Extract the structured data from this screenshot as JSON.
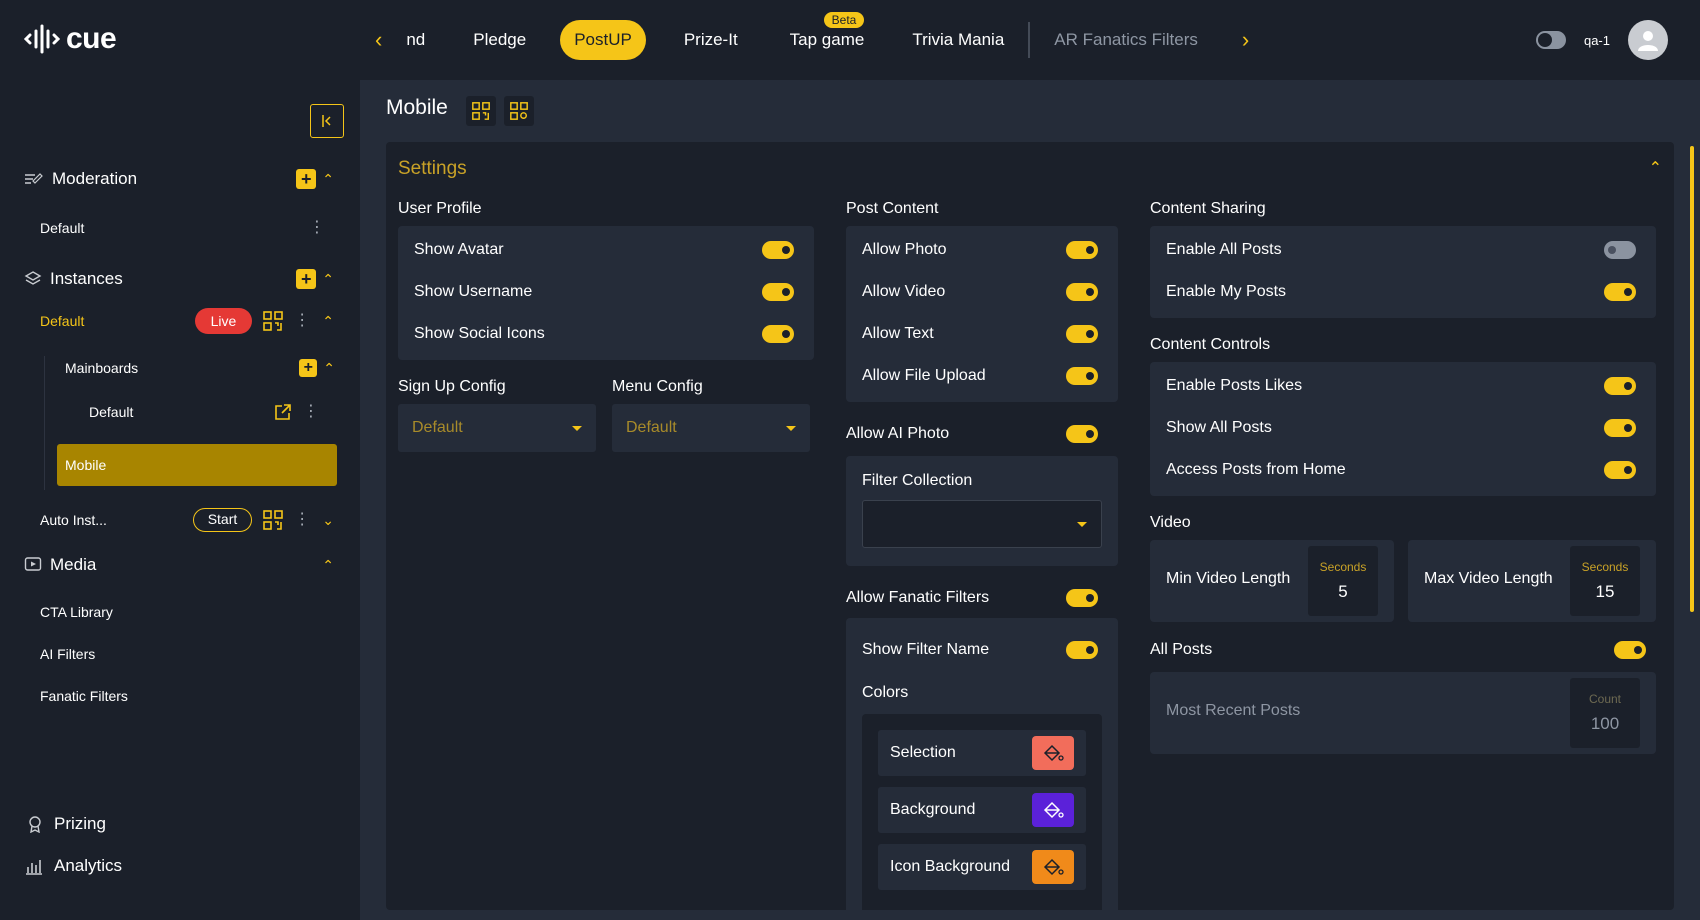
{
  "brand": {
    "logo_text": "cue"
  },
  "tabs": [
    {
      "label": "nd"
    },
    {
      "label": "Pledge"
    },
    {
      "label": "PostUP"
    },
    {
      "label": "Prize-It"
    },
    {
      "label": "Tap game",
      "badge": "Beta"
    },
    {
      "label": "Trivia Mania"
    },
    {
      "label": "AR Fanatics Filters"
    }
  ],
  "user": {
    "name": "qa-1"
  },
  "sidebar": {
    "moderation": {
      "label": "Moderation",
      "items": [
        "Default"
      ]
    },
    "instances": {
      "label": "Instances",
      "default": {
        "label": "Default",
        "status": "Live"
      },
      "mainboards": {
        "label": "Mainboards",
        "items": [
          "Default",
          "Mobile"
        ]
      },
      "auto": {
        "label": "Auto Inst...",
        "action": "Start"
      }
    },
    "media": {
      "label": "Media",
      "items": [
        "CTA Library",
        "AI Filters",
        "Fanatic Filters"
      ]
    },
    "prizing": "Prizing",
    "analytics": "Analytics"
  },
  "main": {
    "title": "Mobile",
    "settings_title": "Settings",
    "user_profile": {
      "label": "User Profile",
      "rows": [
        {
          "label": "Show Avatar",
          "on": true
        },
        {
          "label": "Show Username",
          "on": true
        },
        {
          "label": "Show Social Icons",
          "on": true
        }
      ]
    },
    "sign_up_config": {
      "label": "Sign Up Config",
      "value": "Default"
    },
    "menu_config": {
      "label": "Menu Config",
      "value": "Default"
    },
    "post_content": {
      "label": "Post Content",
      "rows": [
        {
          "label": "Allow Photo",
          "on": true
        },
        {
          "label": "Allow Video",
          "on": true
        },
        {
          "label": "Allow Text",
          "on": true
        },
        {
          "label": "Allow File Upload",
          "on": true
        }
      ]
    },
    "allow_ai_photo": {
      "label": "Allow AI Photo",
      "on": true
    },
    "filter_collection": {
      "label": "Filter Collection",
      "value": ""
    },
    "allow_fanatic_filters": {
      "label": "Allow Fanatic Filters",
      "on": true
    },
    "show_filter_name": {
      "label": "Show Filter Name",
      "on": true
    },
    "colors": {
      "label": "Colors",
      "items": [
        {
          "label": "Selection",
          "color": "#f26d5b"
        },
        {
          "label": "Background",
          "color": "#5b21d9"
        },
        {
          "label": "Icon Background",
          "color": "#f08a1a"
        }
      ]
    },
    "content_sharing": {
      "label": "Content Sharing",
      "rows": [
        {
          "label": "Enable All Posts",
          "on": false
        },
        {
          "label": "Enable My Posts",
          "on": true
        }
      ]
    },
    "content_controls": {
      "label": "Content Controls",
      "rows": [
        {
          "label": "Enable Posts Likes",
          "on": true
        },
        {
          "label": "Show All Posts",
          "on": true
        },
        {
          "label": "Access Posts from Home",
          "on": true
        }
      ]
    },
    "video": {
      "label": "Video",
      "min": {
        "label": "Min Video Length",
        "unit": "Seconds",
        "value": "5"
      },
      "max": {
        "label": "Max Video Length",
        "unit": "Seconds",
        "value": "15"
      }
    },
    "all_posts": {
      "label": "All Posts",
      "on": true,
      "recent": {
        "label": "Most Recent Posts",
        "unit": "Count",
        "value": "100"
      }
    }
  },
  "colors": {
    "accent": "#f5c518",
    "live": "#e53935",
    "bg": "#1b202a",
    "surface": "#252c39"
  }
}
